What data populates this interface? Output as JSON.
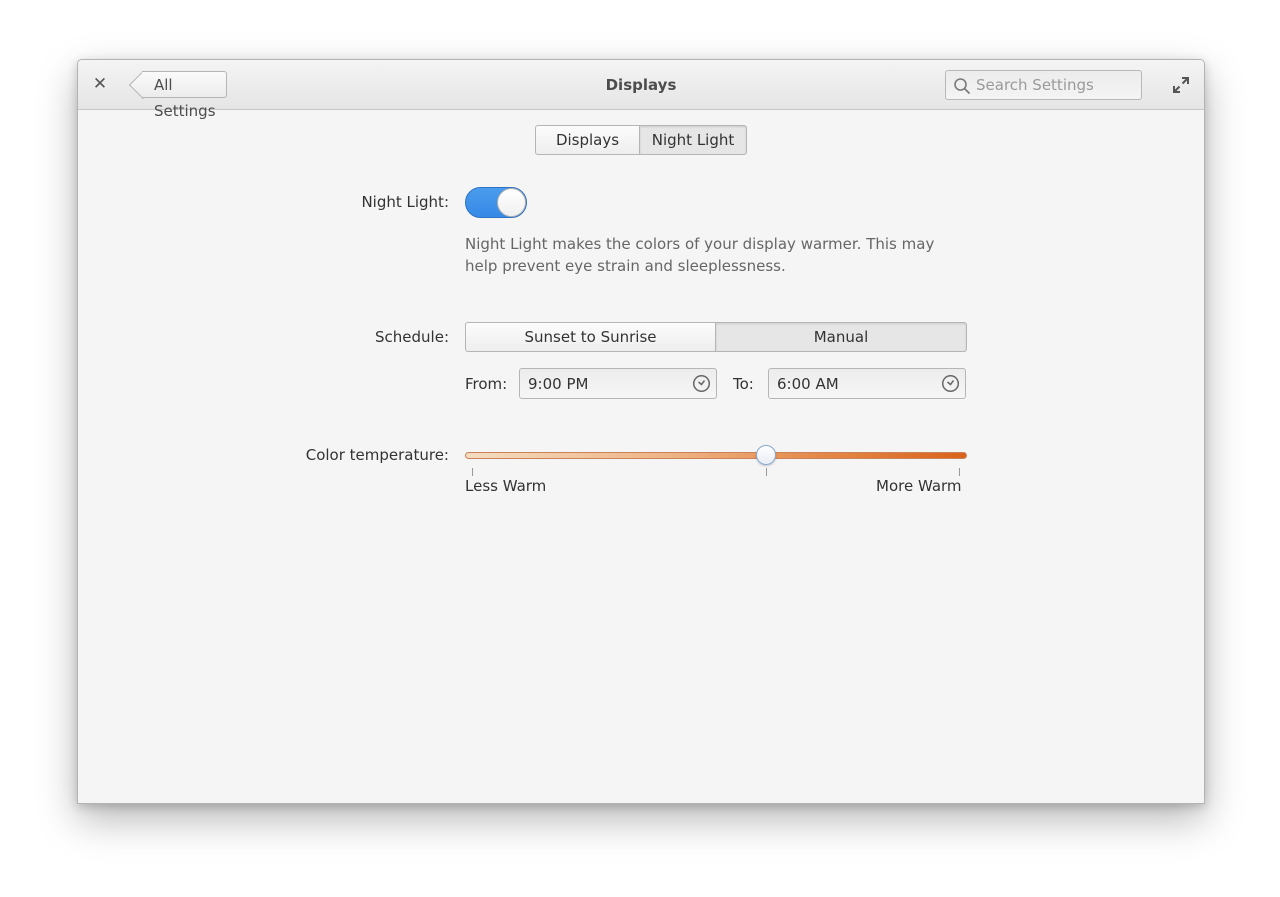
{
  "window": {
    "title": "Displays",
    "back_label": "All Settings",
    "close_icon": "close-icon",
    "maximize_icon": "maximize-icon"
  },
  "search": {
    "placeholder": "Search Settings",
    "value": ""
  },
  "tabs": [
    {
      "label": "Displays",
      "active": false
    },
    {
      "label": "Night Light",
      "active": true
    }
  ],
  "night_light": {
    "label": "Night Light:",
    "enabled": true,
    "description": "Night Light makes the colors of your display warmer. This may help prevent eye strain and sleeplessness."
  },
  "schedule": {
    "label": "Schedule:",
    "options": [
      {
        "label": "Sunset to Sunrise",
        "active": false
      },
      {
        "label": "Manual",
        "active": true
      }
    ],
    "from_label": "From:",
    "from_value": "9:00 PM",
    "to_label": "To:",
    "to_value": "6:00 AM"
  },
  "color_temperature": {
    "label": "Color temperature:",
    "value_fraction": 0.6,
    "min_label": "Less Warm",
    "max_label": "More Warm"
  },
  "colors": {
    "accent": "#3689e6",
    "warm_end": "#d9621c",
    "cool_end": "#f5dcc0"
  }
}
